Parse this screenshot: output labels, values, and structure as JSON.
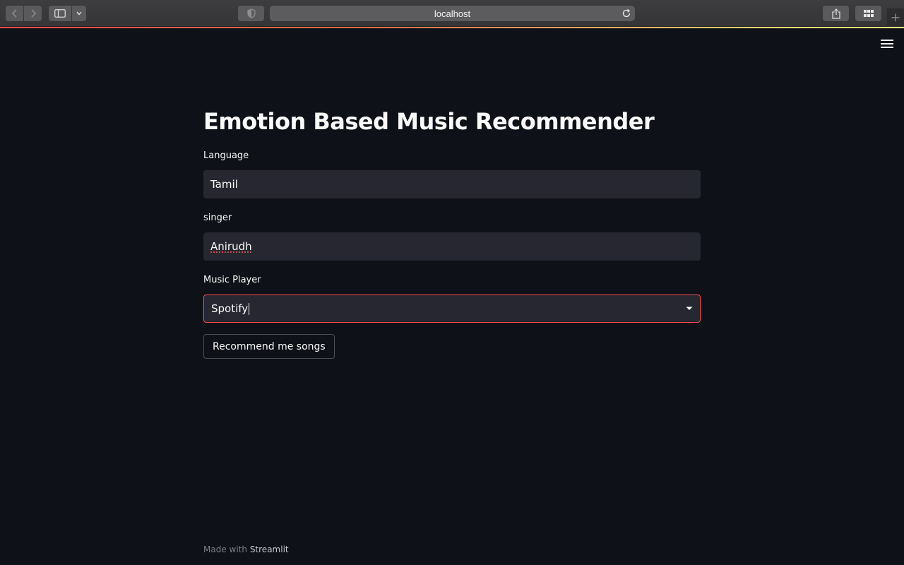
{
  "browser": {
    "address": "localhost",
    "icons": {
      "back": "chevron-left-icon",
      "forward": "chevron-right-icon",
      "sidebar": "sidebar-icon",
      "dropdown": "chevron-down-icon",
      "shield": "shield-icon",
      "reload": "reload-icon",
      "share": "share-icon",
      "tabs": "grid-icon",
      "new_tab": "plus-icon"
    }
  },
  "app": {
    "menu_icon": "hamburger-menu-icon",
    "title": "Emotion Based Music Recommender",
    "fields": {
      "language": {
        "label": "Language",
        "value": "Tamil"
      },
      "singer": {
        "label": "singer",
        "value": "Anirudh"
      },
      "music_player": {
        "label": "Music Player",
        "value": "Spotify"
      }
    },
    "button_label": "Recommend me songs"
  },
  "footer": {
    "prefix": "Made with",
    "brand": "Streamlit"
  },
  "colors": {
    "background": "#0e1117",
    "input_bg": "#262730",
    "accent": "#ff4b4b",
    "text": "#fafafa"
  }
}
